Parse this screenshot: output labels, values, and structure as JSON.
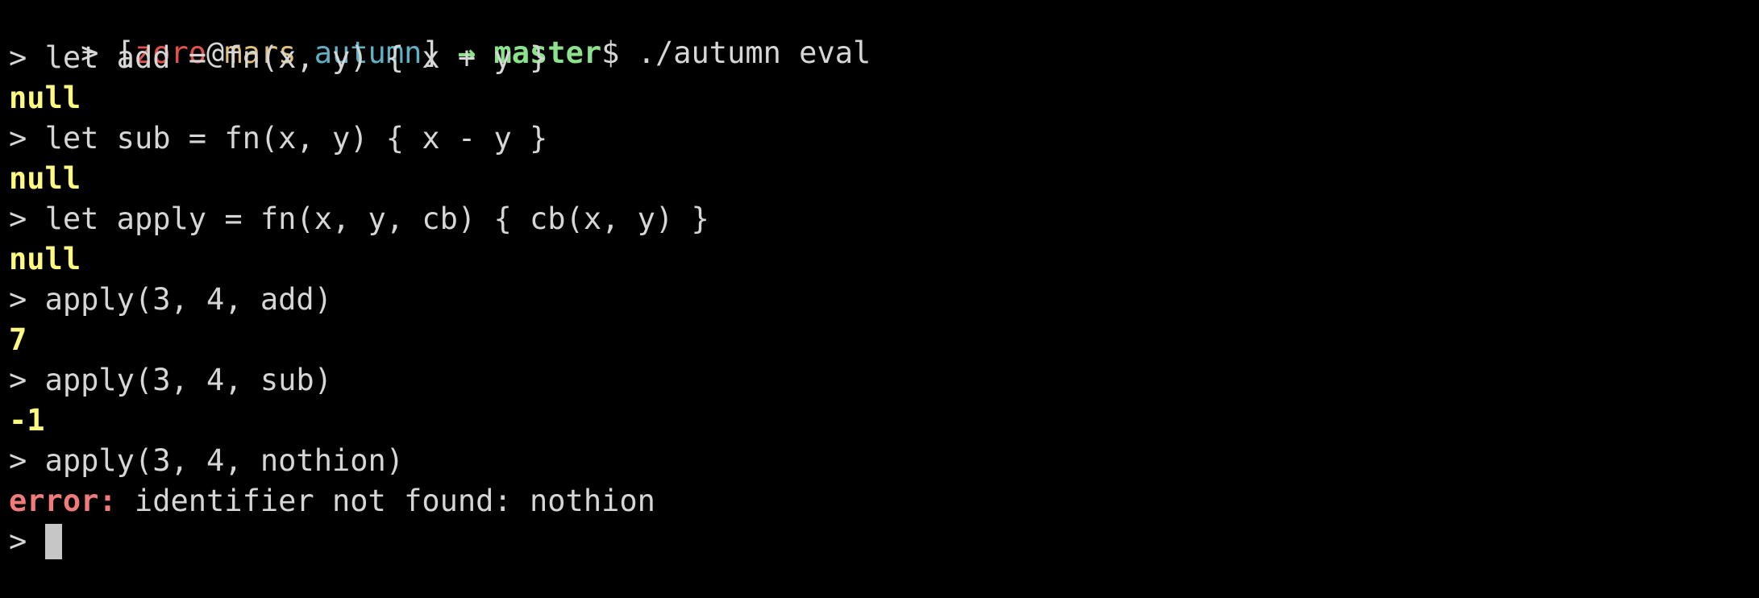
{
  "colors": {
    "background": "#000000",
    "text": "#d6d6d6",
    "user": "#e0534c",
    "host": "#e3c17a",
    "dir": "#5fb2c6",
    "arrow": "#8ae28a",
    "branch": "#8ae28a",
    "output": "#fdf982",
    "error": "#f07b7b",
    "cursor": "#c6c6c6"
  },
  "shell_prompt": {
    "prefix": "> [",
    "user": "zoro",
    "at": "@",
    "host": "mars",
    "space": " ",
    "dir": "autumn",
    "close": "]",
    "arrow": " → ",
    "branch": "master",
    "dollar": "$",
    "command": " ./autumn eval"
  },
  "session": [
    {
      "kind": "input",
      "prompt": "> ",
      "text": "let add = fn(x, y) { x + y }"
    },
    {
      "kind": "output",
      "text": "null"
    },
    {
      "kind": "input",
      "prompt": "> ",
      "text": "let sub = fn(x, y) { x - y }"
    },
    {
      "kind": "output",
      "text": "null"
    },
    {
      "kind": "input",
      "prompt": "> ",
      "text": "let apply = fn(x, y, cb) { cb(x, y) }"
    },
    {
      "kind": "output",
      "text": "null"
    },
    {
      "kind": "input",
      "prompt": "> ",
      "text": "apply(3, 4, add)"
    },
    {
      "kind": "output",
      "text": "7"
    },
    {
      "kind": "input",
      "prompt": "> ",
      "text": "apply(3, 4, sub)"
    },
    {
      "kind": "output",
      "text": "-1"
    },
    {
      "kind": "input",
      "prompt": "> ",
      "text": "apply(3, 4, nothion)"
    },
    {
      "kind": "error",
      "label": "error:",
      "text": " identifier not found: nothion"
    }
  ],
  "active_prompt": "> "
}
